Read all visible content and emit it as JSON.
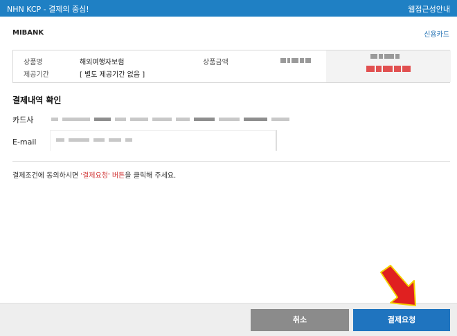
{
  "header": {
    "title": "NHN KCP - 결제의 중심!",
    "accessibility_link": "웹접근성안내"
  },
  "merchant": {
    "name": "MIBANK",
    "payment_method": "신용카드"
  },
  "product": {
    "name_label": "상품명",
    "name_value": "해외여행자보험",
    "period_label": "제공기간",
    "period_value": "[ 별도 제공기간 없음 ]",
    "amount_label": "상품금액"
  },
  "confirm": {
    "section_title": "결제내역 확인",
    "card_label": "카드사",
    "email_label": "E-mail"
  },
  "notice": {
    "prefix": "결제조건에 동의하시면 ",
    "highlight": "'결제요청' 버튼",
    "suffix": "을 클릭해 주세요."
  },
  "buttons": {
    "cancel": "취소",
    "pay": "결제요청"
  },
  "colors": {
    "header_bg": "#1f80c4",
    "primary_button": "#1f74bf",
    "cancel_button": "#8b8b8b",
    "highlight": "#d23a3a",
    "arrow": "#e02020"
  }
}
